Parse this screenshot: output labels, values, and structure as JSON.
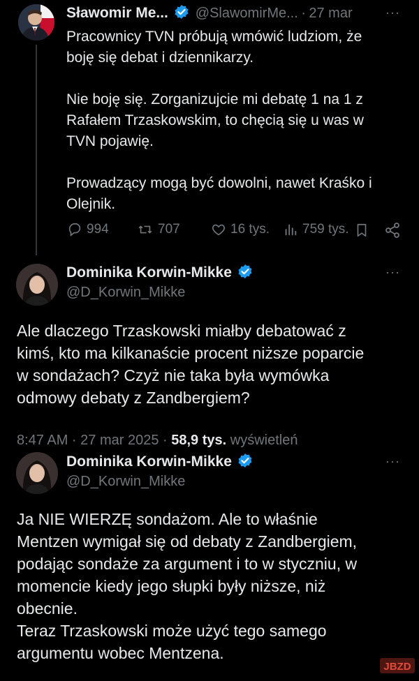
{
  "tweet1": {
    "name": "Sławomir Me...",
    "handle": "@SlawomirMe...",
    "separator": "·",
    "date": "27 mar",
    "more": "···",
    "lines": [
      "Pracownicy TVN próbują wmówić ludziom, że",
      "boję się debat i dziennikarzy.",
      "",
      "Nie boję się. Zorganizujcie mi debatę 1 na 1 z",
      "Rafałem Trzaskowskim, to chęcią się u was w",
      "TVN pojawię.",
      "",
      "Prowadzący mogą być dowolni, nawet Kraśko i",
      "Olejnik."
    ],
    "actions": {
      "replies": "994",
      "reposts": "707",
      "likes": "16 tys.",
      "views": "759 tys."
    },
    "icons": [
      "reply-icon",
      "repost-icon",
      "like-icon",
      "views-icon",
      "bookmark-icon",
      "share-icon"
    ]
  },
  "tweet2": {
    "name": "Dominika Korwin-Mikke",
    "handle": "@D_Korwin_Mikke",
    "more": "···",
    "lines": [
      "Ale dlaczego Trzaskowski miałby debatować z",
      "kimś, kto ma kilkanaście procent niższe poparcie",
      "w sondażach? Czyż nie taka była wymówka",
      "odmowy debaty z Zandbergiem?"
    ],
    "meta_time": "8:47 AM · 27 mar 2025 ·",
    "meta_views": "58,9 tys.",
    "meta_views_label": "wyświetleń"
  },
  "tweet3": {
    "name": "Dominika Korwin-Mikke",
    "handle": "@D_Korwin_Mikke",
    "more": "···",
    "lines": [
      "Ja NIE WIERZĘ sondażom. Ale to właśnie",
      "Mentzen wymigał się od debaty z Zandbergiem,",
      "podając sondaże za argument i to w styczniu, w",
      "momencie kiedy jego słupki były niższe, niż",
      "obecnie.",
      "Teraz Trzaskowski może użyć tego samego",
      "argumentu wobec Mentzena."
    ]
  },
  "watermark": "JBZD",
  "colors": {
    "background": "#000000",
    "text": "#e7e9ea",
    "muted": "#71767b",
    "verified": "#1d9bf0",
    "thread_line": "#333639",
    "watermark": "#c0392b"
  }
}
